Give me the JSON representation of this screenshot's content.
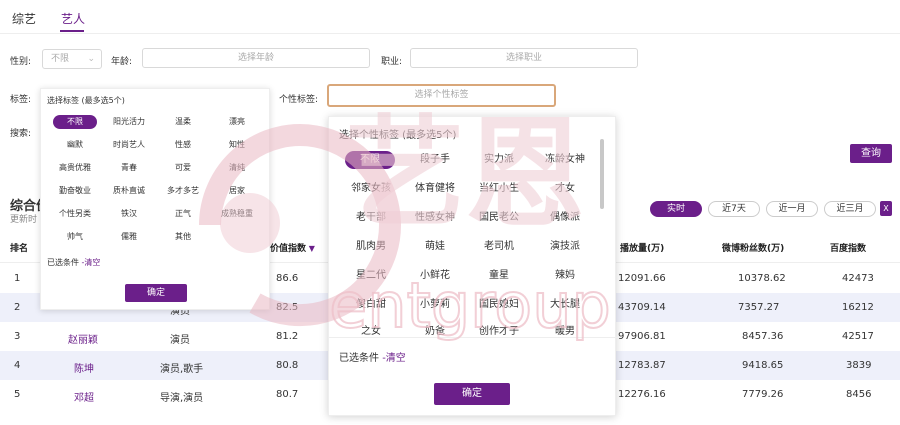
{
  "tabs": [
    "综艺",
    "艺人"
  ],
  "filters": {
    "gender_label": "性别:",
    "gender_value": "不限",
    "age_label": "年龄:",
    "age_placeholder": "选择年龄",
    "job_label": "职业:",
    "job_placeholder": "选择职业",
    "tag_label": "标签:",
    "personal_tag_label": "个性标签:",
    "personal_tag_placeholder": "选择个性标签",
    "search_label": "搜索:",
    "query_button": "查询"
  },
  "section": {
    "title": "综合价",
    "subtitle": "更新时"
  },
  "periods": [
    "实时",
    "近7天",
    "近一月",
    "近三月"
  ],
  "excel_icon": "excel-icon",
  "table": {
    "headers": [
      "排名",
      "价值指数",
      "播放量(万)",
      "微博粉丝数(万)",
      "百度指数"
    ],
    "rows": [
      {
        "rank": "1",
        "name": "",
        "role": "",
        "value": "86.6",
        "play": "12091.66",
        "weibo": "10378.62",
        "baidu": "42473"
      },
      {
        "rank": "2",
        "name": "",
        "role": "演员",
        "value": "82.5",
        "play": "43709.14",
        "weibo": "7357.27",
        "baidu": "16212"
      },
      {
        "rank": "3",
        "name": "赵丽颖",
        "role": "演员",
        "value": "81.2",
        "play": "97906.81",
        "weibo": "8457.36",
        "baidu": "42517"
      },
      {
        "rank": "4",
        "name": "陈坤",
        "role": "演员,歌手",
        "value": "80.8",
        "play": "12783.87",
        "weibo": "9418.65",
        "baidu": "3839"
      },
      {
        "rank": "5",
        "name": "邓超",
        "role": "导演,演员",
        "value": "80.7",
        "play": "12276.16",
        "weibo": "7779.26",
        "baidu": "8456"
      }
    ]
  },
  "tag_dropdown": {
    "header": "选择标签 (最多选5个)",
    "tags": [
      "不限",
      "阳光活力",
      "温柔",
      "漂亮",
      "幽默",
      "时尚艺人",
      "性感",
      "知性",
      "高贵优雅",
      "青春",
      "可爱",
      "清纯",
      "勤奋敬业",
      "质朴直诚",
      "多才多艺",
      "居家",
      "个性另类",
      "铁汉",
      "正气",
      "成熟稳重",
      "帅气",
      "儒雅",
      "其他"
    ],
    "selected_label": "已选条件",
    "clear_label": "-清空",
    "confirm": "确定"
  },
  "personal_dropdown": {
    "header": "选择个性标签 (最多选5个)",
    "tags": [
      "不限",
      "段子手",
      "实力派",
      "冻龄女神",
      "邻家女孩",
      "体育健将",
      "当红小生",
      "才女",
      "老干部",
      "性感女神",
      "国民老公",
      "偶像派",
      "肌肉男",
      "萌娃",
      "老司机",
      "演技派",
      "星二代",
      "小鲜花",
      "童星",
      "辣妈",
      "傻白甜",
      "小萝莉",
      "国民媳妇",
      "大长腿",
      "之女",
      "奶爸",
      "创作才子",
      "暖男"
    ],
    "selected_label": "已选条件",
    "clear_label": "-清空",
    "confirm": "确定"
  },
  "watermark": {
    "cn": "艺恩",
    "en": "entgroup",
    "color": "#f3d6dc"
  }
}
